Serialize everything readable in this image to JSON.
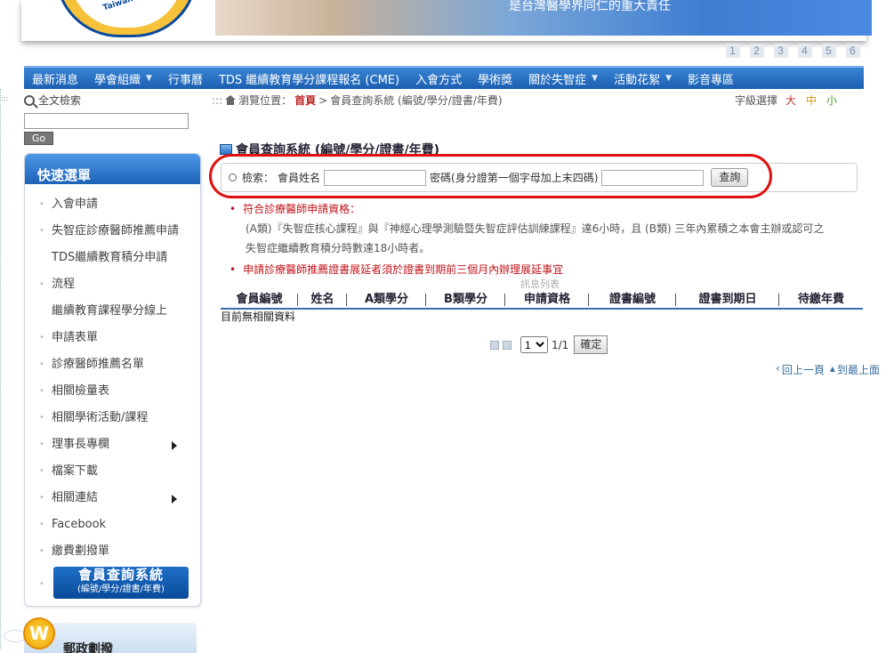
{
  "banner": {
    "logo_text": "Taiwan Dementia Society",
    "slogan": "是台灣醫學界同仁的重大責任"
  },
  "pages": [
    "1",
    "2",
    "3",
    "4",
    "5",
    "6"
  ],
  "nav": [
    {
      "label": "最新消息",
      "dropdown": false
    },
    {
      "label": "學會組織",
      "dropdown": true
    },
    {
      "label": "行事曆",
      "dropdown": false
    },
    {
      "label": "TDS 繼續教育學分課程報名 (CME)",
      "dropdown": false
    },
    {
      "label": "入會方式",
      "dropdown": false
    },
    {
      "label": "學術獎",
      "dropdown": false
    },
    {
      "label": "關於失智症",
      "dropdown": true
    },
    {
      "label": "活動花絮",
      "dropdown": true
    },
    {
      "label": "影音專區",
      "dropdown": false
    }
  ],
  "fulltext": {
    "label": "全文檢索",
    "go": "Go"
  },
  "quickmenu": {
    "title": "快速選單",
    "items": [
      {
        "label": "入會申請",
        "multi": false,
        "arrow": false
      },
      {
        "label": "失智症診療醫師推薦申請",
        "multi": false,
        "arrow": false
      },
      {
        "label": "TDS繼續教育積分申請流程",
        "multi": true,
        "arrow": false
      },
      {
        "label": "繼續教育課程學分線上申請表單",
        "multi": true,
        "arrow": false
      },
      {
        "label": "診療醫師推薦名單",
        "multi": false,
        "arrow": false
      },
      {
        "label": "相關檢量表",
        "multi": false,
        "arrow": false
      },
      {
        "label": "相關學術活動/課程",
        "multi": false,
        "arrow": false
      },
      {
        "label": "理事長專欄",
        "multi": false,
        "arrow": true
      },
      {
        "label": "檔案下載",
        "multi": false,
        "arrow": false
      },
      {
        "label": "相關連結",
        "multi": false,
        "arrow": true
      },
      {
        "label": "Facebook",
        "multi": false,
        "arrow": false
      },
      {
        "label": "繳費劃撥單",
        "multi": false,
        "arrow": false
      }
    ],
    "member_banner_line1": "會員查詢系統",
    "member_banner_line2": "(編號/學分/證書/年費)"
  },
  "postal": {
    "label": "郵政劃撥",
    "coin": "W"
  },
  "breadcrumb": {
    "prefix": "瀏覽位置：",
    "home": "首頁",
    "sep": ">",
    "current": "會員查詢系統 (編號/學分/證書/年費)"
  },
  "fontsize": {
    "label": "字級選擇",
    "large": "大",
    "medium": "中",
    "small": "小"
  },
  "section_title": "會員查詢系統 (編號/學分/證書/年費)",
  "query": {
    "search_label": "檢索：",
    "name_label": "會員姓名",
    "name_value": "",
    "pwd_label": "密碼(身分證第一個字母加上末四碼)",
    "pwd_value": "",
    "submit": "查詢"
  },
  "eligibility": {
    "heading": "符合診療醫師申請資格：",
    "line1": "(A類)『失智症核心課程』與『神經心理學測驗暨失智症評估訓練課程』達6小時，且 (B類) 三年內累積之本會主辦或認可之",
    "line2": "失智症繼續教育積分時數達18小時者。",
    "warning": "申請診療醫師推薦證書展延者須於證書到期前三個月內辦理展延事宜"
  },
  "message_list": "訊息列表",
  "table": {
    "headers": [
      "會員編號",
      "姓名",
      "A類學分",
      "B類學分",
      "申請資格",
      "證書編號",
      "證書到期日",
      "待繳年費"
    ],
    "empty": "目前無相關資料"
  },
  "pager": {
    "selected": "1",
    "total": "1/1",
    "ok": "確定"
  },
  "footer_links": {
    "prev": "回上一頁",
    "top": "到最上面"
  }
}
